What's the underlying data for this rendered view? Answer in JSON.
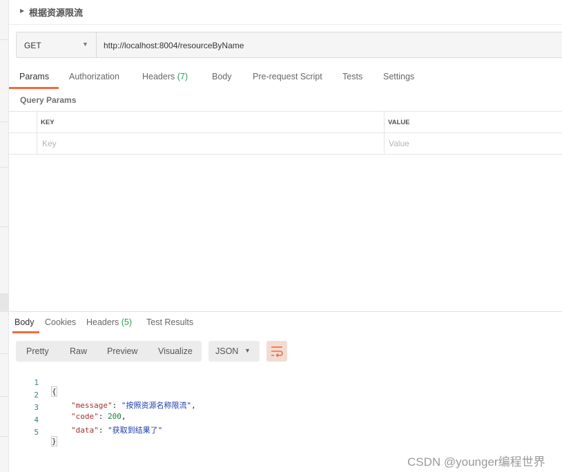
{
  "request": {
    "title": "根据资源限流",
    "method": "GET",
    "url": "http://localhost:8004/resourceByName"
  },
  "request_tabs": [
    {
      "label": "Params"
    },
    {
      "label": "Authorization"
    },
    {
      "label": "Headers",
      "count": "(7)"
    },
    {
      "label": "Body"
    },
    {
      "label": "Pre-request Script"
    },
    {
      "label": "Tests"
    },
    {
      "label": "Settings"
    }
  ],
  "query_params": {
    "section_label": "Query Params",
    "columns": {
      "key": "KEY",
      "value": "VALUE"
    },
    "placeholders": {
      "key": "Key",
      "value": "Value"
    }
  },
  "response_tabs": [
    {
      "label": "Body"
    },
    {
      "label": "Cookies"
    },
    {
      "label": "Headers",
      "count": "(5)"
    },
    {
      "label": "Test Results"
    }
  ],
  "response_view": {
    "buttons": [
      "Pretty",
      "Raw",
      "Preview",
      "Visualize"
    ],
    "format": "JSON"
  },
  "response_body": {
    "line_numbers": [
      "1",
      "2",
      "3",
      "4",
      "5"
    ],
    "open_brace": "{",
    "close_brace": "}",
    "fields": [
      {
        "key": "\"message\"",
        "value": "\"按照资源名称限流\"",
        "sep": ","
      },
      {
        "key": "\"code\"",
        "value": "200",
        "sep": ","
      },
      {
        "key": "\"data\"",
        "value": "\"获取到结果了\"",
        "sep": ""
      }
    ]
  },
  "watermark": "CSDN @younger编程世界",
  "colors": {
    "accent": "#f26b3a",
    "count_green": "#26a150",
    "json_key": "#a4302e",
    "json_string": "#1a3aa8",
    "json_number": "#1a7a3a"
  }
}
